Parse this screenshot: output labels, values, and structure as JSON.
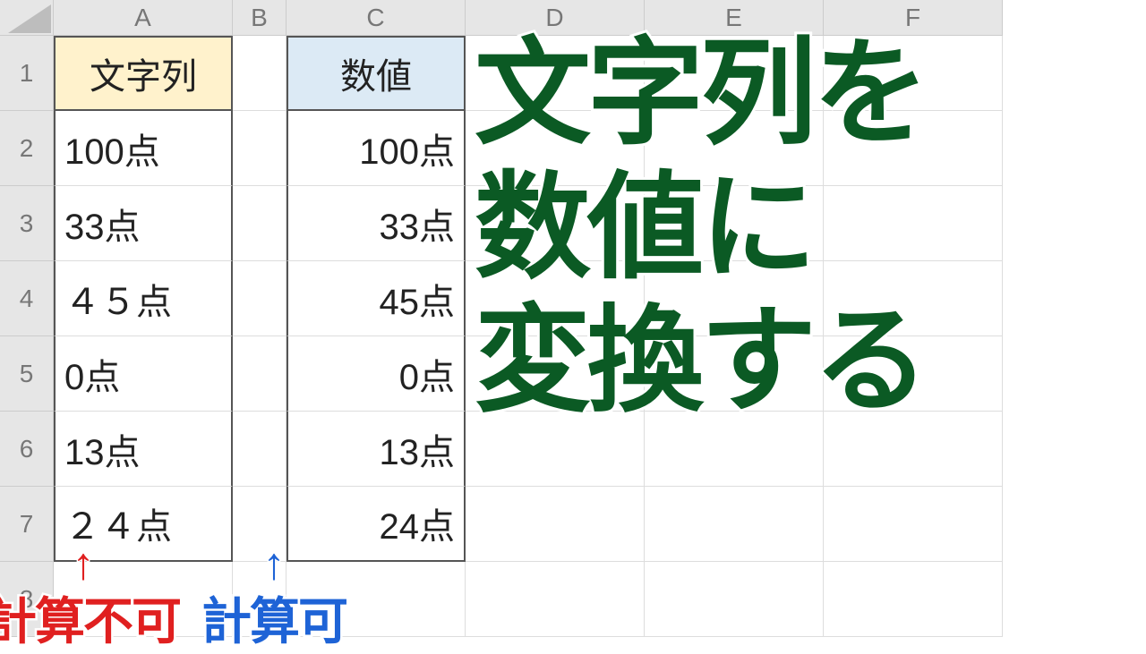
{
  "columns": [
    "A",
    "B",
    "C",
    "D",
    "E",
    "F"
  ],
  "rows": [
    "1",
    "2",
    "3",
    "4",
    "5",
    "6",
    "7",
    "8"
  ],
  "headers": {
    "A1": "文字列",
    "C1": "数値"
  },
  "data": {
    "A": [
      "100点",
      "33点",
      "４５点",
      "0点",
      "13点",
      "２４点"
    ],
    "C": [
      "100点",
      "33点",
      "45点",
      "0点",
      "13点",
      "24点"
    ]
  },
  "overlay_title": "文字列を\n数値に\n変換する",
  "annotations": {
    "red": {
      "arrow": "↑",
      "label": "計算不可"
    },
    "blue": {
      "arrow": "↑",
      "label": "計算可"
    }
  }
}
